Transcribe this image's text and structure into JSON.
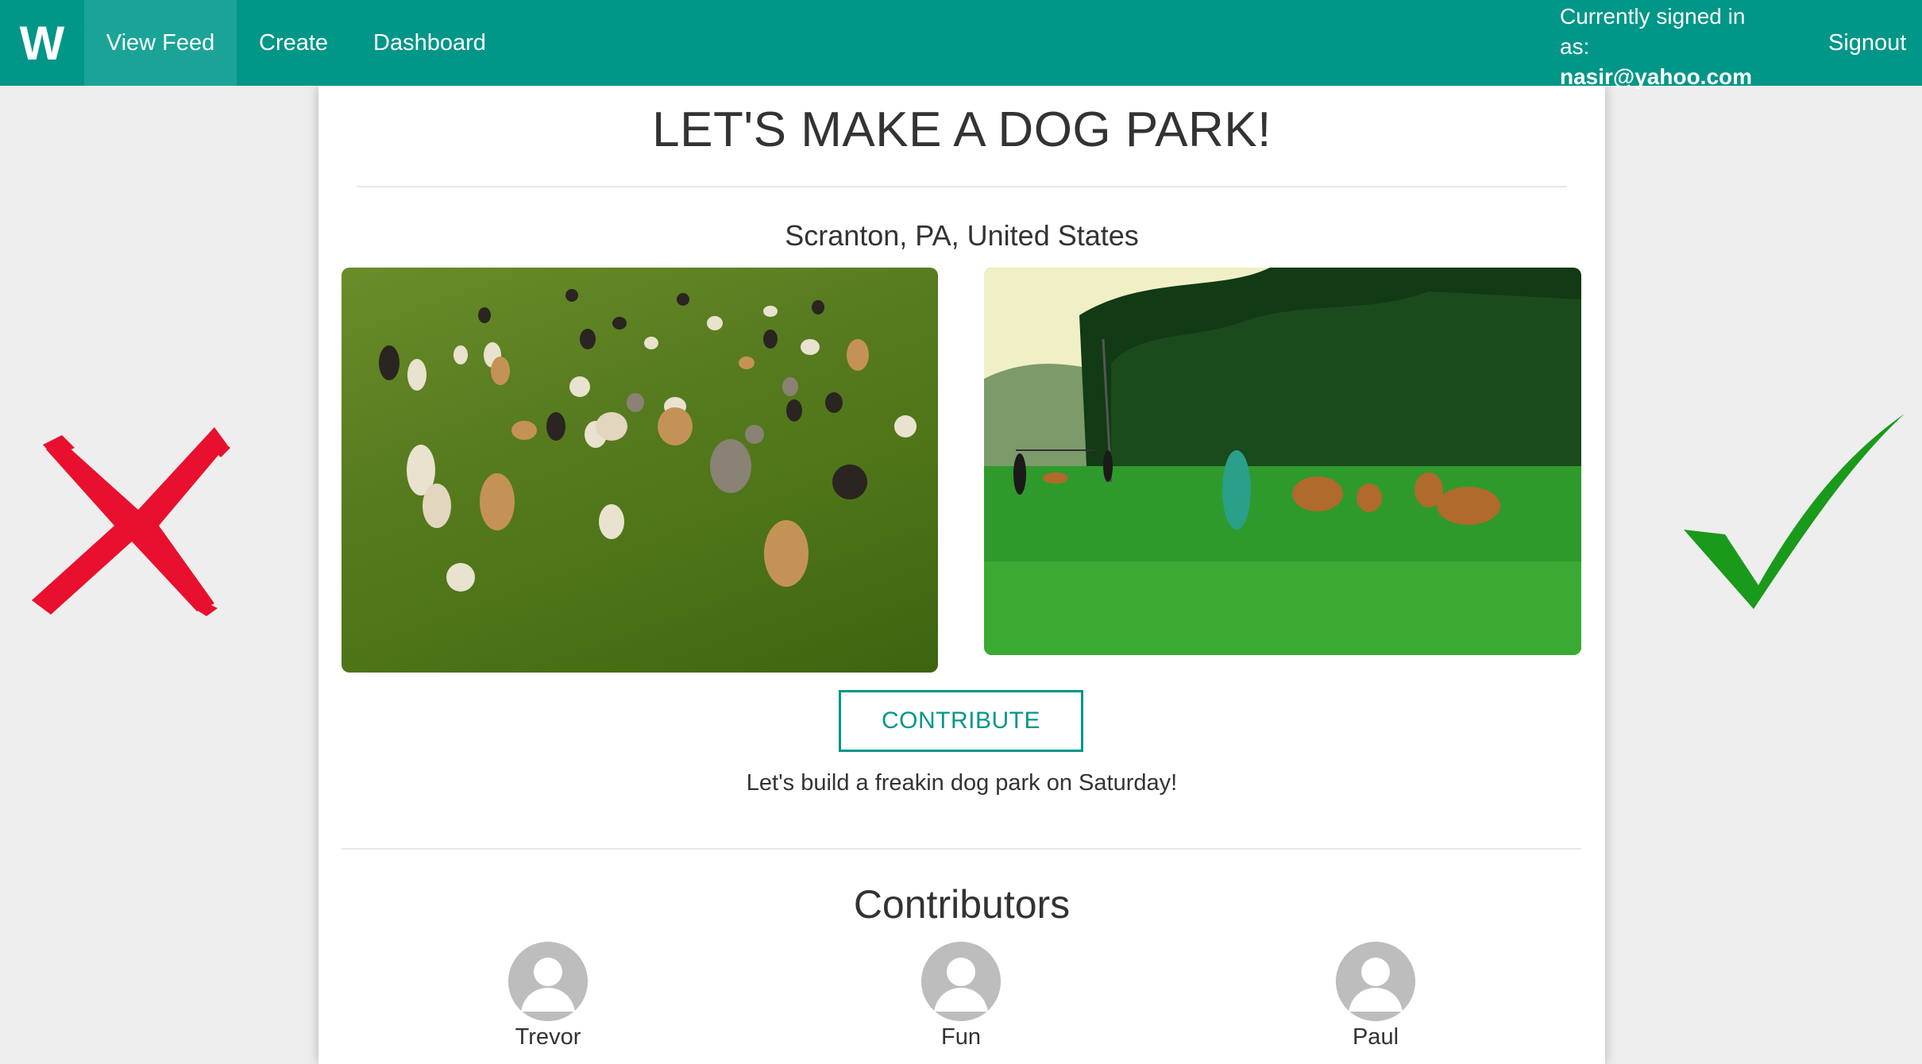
{
  "nav": {
    "brand": "W",
    "items": [
      {
        "label": "View Feed",
        "active": true
      },
      {
        "label": "Create"
      },
      {
        "label": "Dashboard"
      }
    ],
    "signed_in_label": "Currently signed in as:",
    "signed_in_email": "nasir@yahoo.com",
    "signout_label": "Signout"
  },
  "project": {
    "title": "LET'S MAKE A DOG PARK!",
    "location": "Scranton, PA, United States",
    "contribute_label": "CONTRIBUTE",
    "description": "Let's build a freakin dog park on Saturday!"
  },
  "contributors": {
    "title": "Contributors",
    "people": [
      {
        "name": "Trevor"
      },
      {
        "name": "Fun"
      },
      {
        "name": "Paul"
      }
    ]
  },
  "colors": {
    "accent": "#009688",
    "reject": "#e8102e",
    "approve": "#1a9a1a"
  },
  "icons": {
    "reject": "x-icon",
    "approve": "checkmark-icon",
    "avatar": "user-avatar-icon"
  }
}
